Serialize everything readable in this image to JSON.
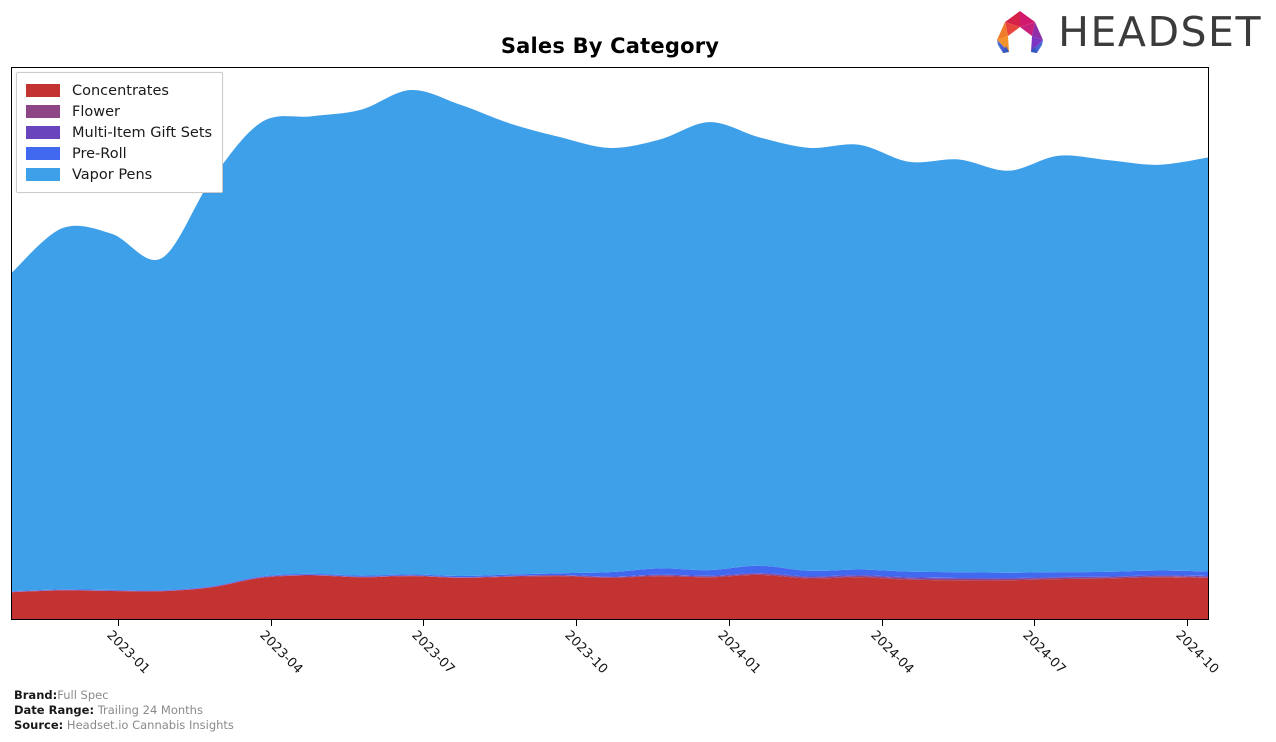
{
  "header": {
    "title": "Sales By Category",
    "logo_text": "HEADSET",
    "logo_icon": "headset-arch-logo"
  },
  "legend": {
    "position": "top-left",
    "items": [
      {
        "label": "Concentrates",
        "color": "#c33332"
      },
      {
        "label": "Flower",
        "color": "#8e4585"
      },
      {
        "label": "Multi-Item Gift Sets",
        "color": "#6a44bd"
      },
      {
        "label": "Pre-Roll",
        "color": "#4169f0"
      },
      {
        "label": "Vapor Pens",
        "color": "#3fa0ea"
      }
    ]
  },
  "footer": {
    "lines": [
      {
        "key": "Brand:",
        "value": "Full Spec"
      },
      {
        "key": "Date Range:",
        "value": " Trailing 24 Months"
      },
      {
        "key": "Source:",
        "value": " Headset.io Cannabis Insights"
      }
    ]
  },
  "chart_data": {
    "type": "area",
    "stacked": true,
    "normalized": false,
    "title": "Sales By Category",
    "xlabel": "",
    "ylabel": "",
    "grid": false,
    "y_tick_labels": [],
    "legend_position": "upper left",
    "x_tick_labels": [
      "2023-01",
      "2023-04",
      "2023-07",
      "2023-10",
      "2024-01",
      "2024-04",
      "2024-07",
      "2024-10"
    ],
    "x_tick_positions": [
      0.0893,
      0.2168,
      0.3443,
      0.4718,
      0.5993,
      0.7268,
      0.8543,
      0.9818
    ],
    "x": [
      "2022-10",
      "2022-11",
      "2022-12",
      "2023-01",
      "2023-02",
      "2023-03",
      "2023-04",
      "2023-05",
      "2023-06",
      "2023-07",
      "2023-08",
      "2023-09",
      "2023-10",
      "2023-11",
      "2023-12",
      "2024-01",
      "2024-02",
      "2024-03",
      "2024-04",
      "2024-05",
      "2024-06",
      "2024-07",
      "2024-08",
      "2024-09",
      "2024-10"
    ],
    "series": [
      {
        "name": "Concentrates",
        "color": "#c33332",
        "values": [
          0.045,
          0.048,
          0.047,
          0.0465,
          0.053,
          0.069,
          0.073,
          0.07,
          0.072,
          0.069,
          0.071,
          0.072,
          0.069,
          0.072,
          0.07,
          0.074,
          0.068,
          0.07,
          0.066,
          0.065,
          0.065,
          0.067,
          0.068,
          0.07,
          0.069
        ]
      },
      {
        "name": "Flower",
        "color": "#8e4585",
        "values": [
          0.0005,
          0.0005,
          0.0005,
          0.0005,
          0.0006,
          0.0008,
          0.0008,
          0.0008,
          0.0008,
          0.0008,
          0.0009,
          0.0012,
          0.0014,
          0.0016,
          0.0016,
          0.0018,
          0.002,
          0.0022,
          0.0024,
          0.0024,
          0.0022,
          0.0022,
          0.002,
          0.002,
          0.002
        ]
      },
      {
        "name": "Multi-Item Gift Sets",
        "color": "#6a44bd",
        "values": [
          0.0003,
          0.0003,
          0.0003,
          0.0003,
          0.0003,
          0.0004,
          0.0004,
          0.0004,
          0.0004,
          0.0004,
          0.0005,
          0.0006,
          0.0008,
          0.0009,
          0.001,
          0.0012,
          0.0014,
          0.0014,
          0.0016,
          0.0015,
          0.0014,
          0.0013,
          0.0012,
          0.0012,
          0.0012
        ]
      },
      {
        "name": "Pre-Roll",
        "color": "#4169f0",
        "values": [
          0.001,
          0.001,
          0.001,
          0.0012,
          0.0012,
          0.0014,
          0.0016,
          0.0016,
          0.0018,
          0.002,
          0.0022,
          0.003,
          0.0075,
          0.0105,
          0.0095,
          0.0125,
          0.0095,
          0.0095,
          0.0095,
          0.0095,
          0.009,
          0.0082,
          0.008,
          0.0082,
          0.0075
        ]
      },
      {
        "name": "Vapor Pens",
        "color": "#3fa0ea",
        "values": [
          0.535,
          0.606,
          0.598,
          0.557,
          0.682,
          0.762,
          0.768,
          0.782,
          0.813,
          0.791,
          0.757,
          0.732,
          0.712,
          0.72,
          0.752,
          0.719,
          0.71,
          0.713,
          0.688,
          0.693,
          0.675,
          0.699,
          0.691,
          0.681,
          0.695
        ]
      }
    ]
  }
}
